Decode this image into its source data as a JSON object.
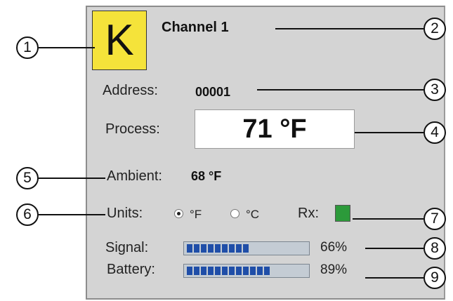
{
  "channel": {
    "type_letter": "K",
    "name": "Channel 1",
    "address_label": "Address:",
    "address_value": "00001",
    "process_label": "Process:",
    "process_value": "71 °F",
    "ambient_label": "Ambient:",
    "ambient_value": "68 °F",
    "units_label": "Units:",
    "units_options": [
      "°F",
      "°C"
    ],
    "units_selected": "°F",
    "rx_label": "Rx:",
    "signal_label": "Signal:",
    "signal_value": "66%",
    "signal_fraction": 0.66,
    "battery_label": "Battery:",
    "battery_value": "89%",
    "battery_fraction": 0.89
  },
  "colors": {
    "type_box": "#f5e33a",
    "rx_indicator": "#2c9a3a",
    "bar_fill": "#1f4ea8",
    "panel": "#d4d4d4"
  },
  "callouts": [
    "1",
    "2",
    "3",
    "4",
    "5",
    "6",
    "7",
    "8",
    "9"
  ]
}
